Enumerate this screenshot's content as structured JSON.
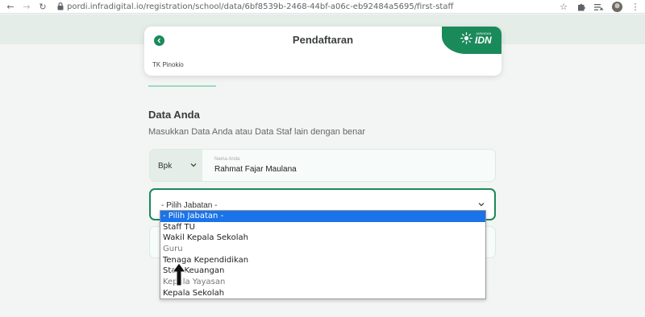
{
  "browser": {
    "url": "pordi.infradigital.io/registration/school/data/6bf8539b-2468-44bf-a06c-eb92484a5695/first-staff",
    "back_icon": "arrow-left-icon",
    "forward_icon": "arrow-right-icon",
    "reload_icon": "reload-icon",
    "lock_icon": "lock-icon"
  },
  "header": {
    "title": "Pendaftaran",
    "school": "TK Pinokio",
    "brand_small": "JARINGAN",
    "brand_big": "IDN",
    "accent_color": "#1a8a5a"
  },
  "section": {
    "title": "Data Anda",
    "subtitle": "Masukkan Data Anda atau Data Staf lain dengan benar"
  },
  "form": {
    "salutation": "Bpk",
    "name_label": "Nama Anda",
    "name_value": "Rahmat Fajar Maulana",
    "jabatan_value": "- Pilih Jabatan -",
    "jabatan_options": [
      "- Pilih Jabatan -",
      "Staff TU",
      "Wakil Kepala Sekolah",
      "Guru",
      "Tenaga Kependidikan",
      "Staff Keuangan",
      "Kepala Yayasan",
      "Kepala Sekolah"
    ]
  }
}
